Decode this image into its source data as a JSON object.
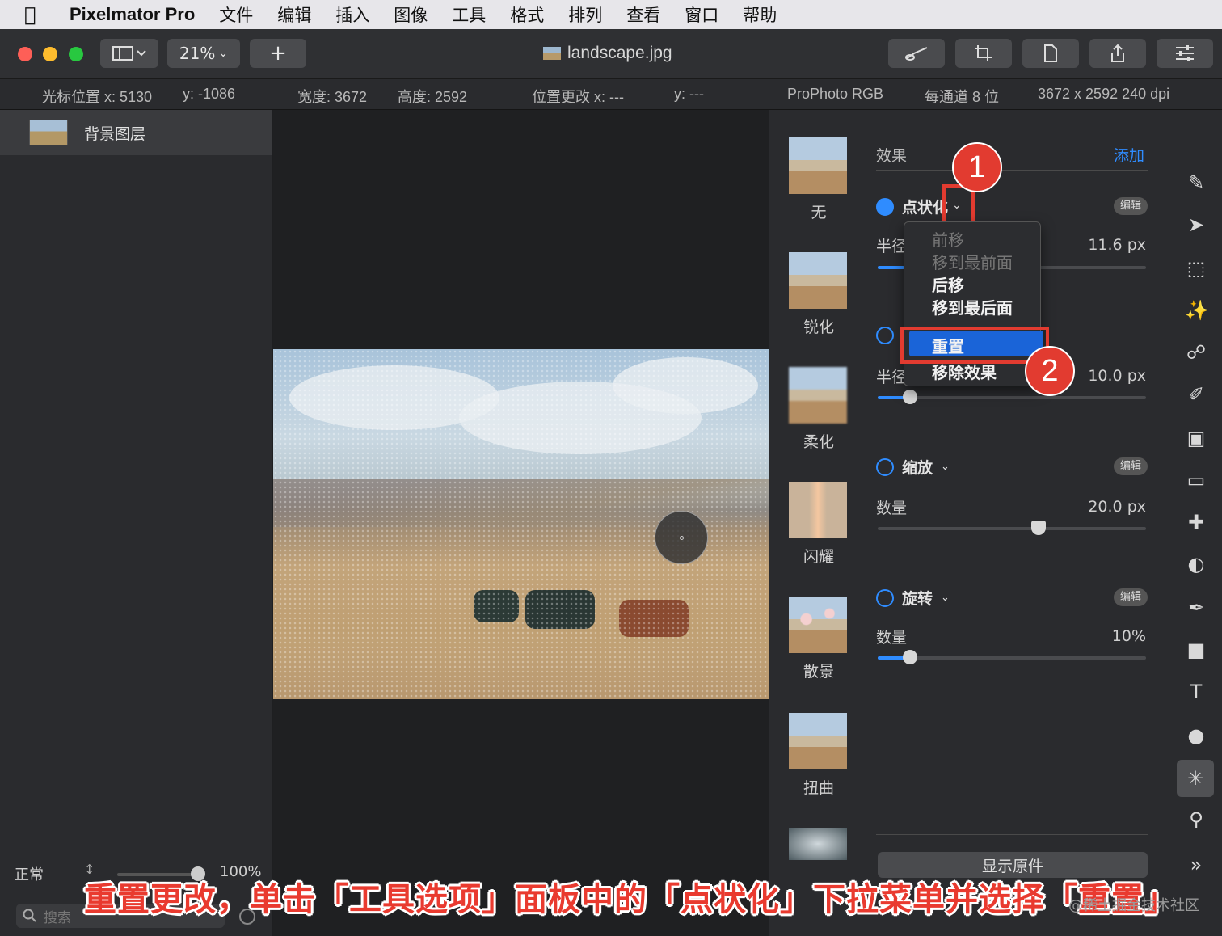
{
  "menubar": {
    "app": "Pixelmator Pro",
    "items": [
      "文件",
      "编辑",
      "插入",
      "图像",
      "工具",
      "格式",
      "排列",
      "查看",
      "窗口",
      "帮助"
    ]
  },
  "toolbar": {
    "zoom": "21%",
    "add": "+",
    "filename": "landscape.jpg"
  },
  "infobar": {
    "cursor_x": "光标位置 x:  5130",
    "cursor_y": "y:  -1086",
    "width": "宽度:  3672",
    "height": "高度:  2592",
    "pos_x": "位置更改 x:  ---",
    "pos_y": "y:  ---",
    "profile": "ProPhoto RGB",
    "depth": "每通道 8 位",
    "size": "3672 x 2592 240 dpi"
  },
  "layers": {
    "layer_name": "背景图层",
    "blend_mode": "正常",
    "opacity": "100%",
    "search_placeholder": "搜索"
  },
  "presets": [
    "无",
    "锐化",
    "柔化",
    "闪耀",
    "散景",
    "扭曲"
  ],
  "effects": {
    "section_title": "效果",
    "add_label": "添加",
    "edit_label": "编辑",
    "pointillize": {
      "title": "点状化",
      "param": "半径",
      "value": "11.6 px",
      "level": 0.1
    },
    "second": {
      "param": "半径",
      "value": "10.0 px",
      "level": 0.12
    },
    "zoom": {
      "title": "缩放",
      "param": "数量",
      "value": "20.0 px",
      "level": 0.6
    },
    "rotate": {
      "title": "旋转",
      "param": "数量",
      "value": "10%",
      "level": 0.12
    },
    "show_original": "显示原件"
  },
  "dropdown": {
    "items": [
      {
        "label": "前移",
        "state": "disabled"
      },
      {
        "label": "移到最前面",
        "state": "disabled"
      },
      {
        "label": "后移",
        "state": "enabled"
      },
      {
        "label": "移到最后面",
        "state": "enabled"
      },
      {
        "label": "重置",
        "state": "selected"
      },
      {
        "label": "移除效果",
        "state": "enabled"
      }
    ]
  },
  "callouts": {
    "one": "1",
    "two": "2"
  },
  "caption": "重置更改，单击「工具选项」面板中的「点状化」下拉菜单并选择「重置」",
  "watermark": "@稀土掘金技术社区",
  "colors": {
    "accent": "#2f8cff",
    "callout": "#e23b30",
    "selected": "#1a64d8"
  }
}
